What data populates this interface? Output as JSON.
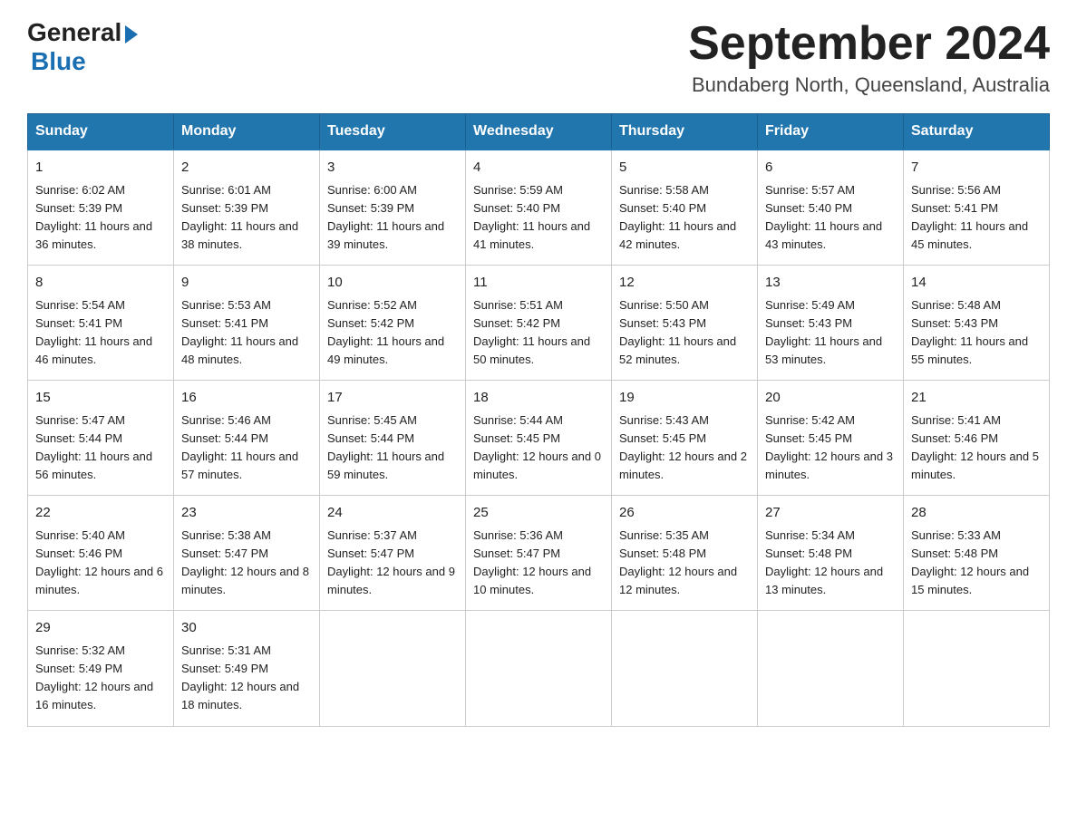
{
  "header": {
    "logo_general": "General",
    "logo_blue": "Blue",
    "month_title": "September 2024",
    "location": "Bundaberg North, Queensland, Australia"
  },
  "days_of_week": [
    "Sunday",
    "Monday",
    "Tuesday",
    "Wednesday",
    "Thursday",
    "Friday",
    "Saturday"
  ],
  "weeks": [
    [
      {
        "day": "1",
        "sunrise": "6:02 AM",
        "sunset": "5:39 PM",
        "daylight": "11 hours and 36 minutes."
      },
      {
        "day": "2",
        "sunrise": "6:01 AM",
        "sunset": "5:39 PM",
        "daylight": "11 hours and 38 minutes."
      },
      {
        "day": "3",
        "sunrise": "6:00 AM",
        "sunset": "5:39 PM",
        "daylight": "11 hours and 39 minutes."
      },
      {
        "day": "4",
        "sunrise": "5:59 AM",
        "sunset": "5:40 PM",
        "daylight": "11 hours and 41 minutes."
      },
      {
        "day": "5",
        "sunrise": "5:58 AM",
        "sunset": "5:40 PM",
        "daylight": "11 hours and 42 minutes."
      },
      {
        "day": "6",
        "sunrise": "5:57 AM",
        "sunset": "5:40 PM",
        "daylight": "11 hours and 43 minutes."
      },
      {
        "day": "7",
        "sunrise": "5:56 AM",
        "sunset": "5:41 PM",
        "daylight": "11 hours and 45 minutes."
      }
    ],
    [
      {
        "day": "8",
        "sunrise": "5:54 AM",
        "sunset": "5:41 PM",
        "daylight": "11 hours and 46 minutes."
      },
      {
        "day": "9",
        "sunrise": "5:53 AM",
        "sunset": "5:41 PM",
        "daylight": "11 hours and 48 minutes."
      },
      {
        "day": "10",
        "sunrise": "5:52 AM",
        "sunset": "5:42 PM",
        "daylight": "11 hours and 49 minutes."
      },
      {
        "day": "11",
        "sunrise": "5:51 AM",
        "sunset": "5:42 PM",
        "daylight": "11 hours and 50 minutes."
      },
      {
        "day": "12",
        "sunrise": "5:50 AM",
        "sunset": "5:43 PM",
        "daylight": "11 hours and 52 minutes."
      },
      {
        "day": "13",
        "sunrise": "5:49 AM",
        "sunset": "5:43 PM",
        "daylight": "11 hours and 53 minutes."
      },
      {
        "day": "14",
        "sunrise": "5:48 AM",
        "sunset": "5:43 PM",
        "daylight": "11 hours and 55 minutes."
      }
    ],
    [
      {
        "day": "15",
        "sunrise": "5:47 AM",
        "sunset": "5:44 PM",
        "daylight": "11 hours and 56 minutes."
      },
      {
        "day": "16",
        "sunrise": "5:46 AM",
        "sunset": "5:44 PM",
        "daylight": "11 hours and 57 minutes."
      },
      {
        "day": "17",
        "sunrise": "5:45 AM",
        "sunset": "5:44 PM",
        "daylight": "11 hours and 59 minutes."
      },
      {
        "day": "18",
        "sunrise": "5:44 AM",
        "sunset": "5:45 PM",
        "daylight": "12 hours and 0 minutes."
      },
      {
        "day": "19",
        "sunrise": "5:43 AM",
        "sunset": "5:45 PM",
        "daylight": "12 hours and 2 minutes."
      },
      {
        "day": "20",
        "sunrise": "5:42 AM",
        "sunset": "5:45 PM",
        "daylight": "12 hours and 3 minutes."
      },
      {
        "day": "21",
        "sunrise": "5:41 AM",
        "sunset": "5:46 PM",
        "daylight": "12 hours and 5 minutes."
      }
    ],
    [
      {
        "day": "22",
        "sunrise": "5:40 AM",
        "sunset": "5:46 PM",
        "daylight": "12 hours and 6 minutes."
      },
      {
        "day": "23",
        "sunrise": "5:38 AM",
        "sunset": "5:47 PM",
        "daylight": "12 hours and 8 minutes."
      },
      {
        "day": "24",
        "sunrise": "5:37 AM",
        "sunset": "5:47 PM",
        "daylight": "12 hours and 9 minutes."
      },
      {
        "day": "25",
        "sunrise": "5:36 AM",
        "sunset": "5:47 PM",
        "daylight": "12 hours and 10 minutes."
      },
      {
        "day": "26",
        "sunrise": "5:35 AM",
        "sunset": "5:48 PM",
        "daylight": "12 hours and 12 minutes."
      },
      {
        "day": "27",
        "sunrise": "5:34 AM",
        "sunset": "5:48 PM",
        "daylight": "12 hours and 13 minutes."
      },
      {
        "day": "28",
        "sunrise": "5:33 AM",
        "sunset": "5:48 PM",
        "daylight": "12 hours and 15 minutes."
      }
    ],
    [
      {
        "day": "29",
        "sunrise": "5:32 AM",
        "sunset": "5:49 PM",
        "daylight": "12 hours and 16 minutes."
      },
      {
        "day": "30",
        "sunrise": "5:31 AM",
        "sunset": "5:49 PM",
        "daylight": "12 hours and 18 minutes."
      },
      null,
      null,
      null,
      null,
      null
    ]
  ]
}
